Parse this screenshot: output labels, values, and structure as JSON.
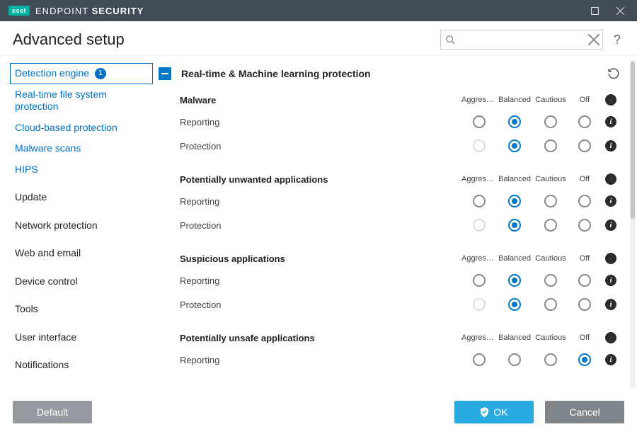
{
  "titlebar": {
    "brand_badge": "eset",
    "brand_light": "ENDPOINT",
    "brand_bold": "SECURITY"
  },
  "header": {
    "title": "Advanced setup",
    "search_placeholder": ""
  },
  "sidebar": {
    "items": [
      {
        "label": "Detection engine",
        "link": true,
        "selected": true,
        "badge": "1"
      },
      {
        "label": "Real-time file system protection",
        "link": true
      },
      {
        "label": "Cloud-based protection",
        "link": true
      },
      {
        "label": "Malware scans",
        "link": true
      },
      {
        "label": "HIPS",
        "link": true
      },
      {
        "gap": true
      },
      {
        "label": "Update"
      },
      {
        "gap": true
      },
      {
        "label": "Network protection"
      },
      {
        "gap": true
      },
      {
        "label": "Web and email"
      },
      {
        "gap": true
      },
      {
        "label": "Device control"
      },
      {
        "gap": true
      },
      {
        "label": "Tools"
      },
      {
        "gap": true
      },
      {
        "label": "User interface"
      },
      {
        "gap": true
      },
      {
        "label": "Notifications"
      }
    ]
  },
  "columns": {
    "aggressive": "Aggressi...",
    "balanced": "Balanced",
    "cautious": "Cautious",
    "off": "Off"
  },
  "section_title": "Real-time & Machine learning protection",
  "groups": [
    {
      "title": "Malware",
      "rows": [
        {
          "label": "Reporting",
          "selected": 1,
          "agg_disabled": false
        },
        {
          "label": "Protection",
          "selected": 1,
          "agg_disabled": true
        }
      ]
    },
    {
      "title": "Potentially unwanted applications",
      "rows": [
        {
          "label": "Reporting",
          "selected": 1,
          "agg_disabled": false
        },
        {
          "label": "Protection",
          "selected": 1,
          "agg_disabled": true
        }
      ]
    },
    {
      "title": "Suspicious applications",
      "rows": [
        {
          "label": "Reporting",
          "selected": 1,
          "agg_disabled": false
        },
        {
          "label": "Protection",
          "selected": 1,
          "agg_disabled": true
        }
      ]
    },
    {
      "title": "Potentially unsafe applications",
      "rows": [
        {
          "label": "Reporting",
          "selected": 3,
          "agg_disabled": false
        }
      ]
    }
  ],
  "footer": {
    "default": "Default",
    "ok": "OK",
    "cancel": "Cancel"
  }
}
